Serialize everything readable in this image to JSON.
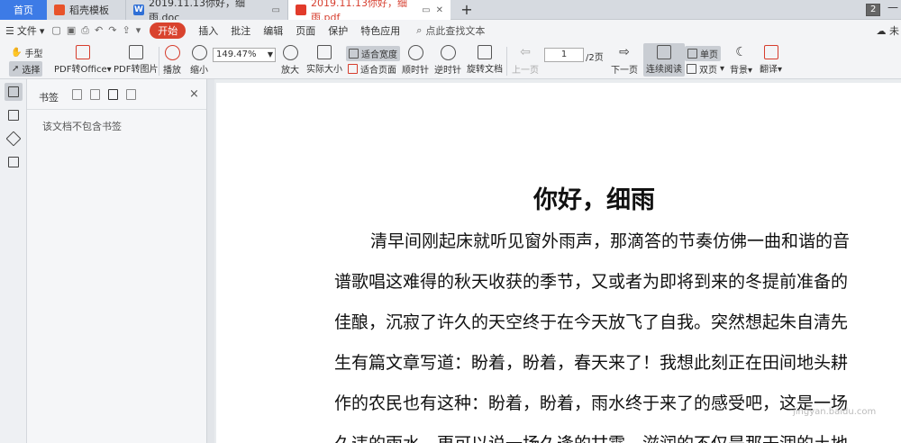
{
  "tabs": {
    "home": "首页",
    "tab1": "稻壳模板",
    "tab2": "2019.11.13你好，细雨.doc",
    "tab3": "2019.11.13你好，细雨.pdf",
    "doc_icon_letter": "W",
    "add": "+",
    "count": "2"
  },
  "menu": {
    "file": "文件",
    "start": "开始",
    "items": [
      "插入",
      "批注",
      "编辑",
      "页面",
      "保护",
      "特色应用"
    ],
    "search_hint": "点此查找文本",
    "cloud": "未"
  },
  "ribbon": {
    "hand": "手型",
    "select": "选择",
    "pdf_to_office": "PDF转Office",
    "pdf_to_image": "PDF转图片",
    "play": "播放",
    "zoom_out": "缩小",
    "zoom_value": "149.47%",
    "zoom_in": "放大",
    "actual_size": "实际大小",
    "fit_width": "适合宽度",
    "fit_page": "适合页面",
    "rotate_cw": "顺时针",
    "rotate_ccw": "逆时针",
    "rotate_doc": "旋转文档",
    "prev_page": "上一页",
    "page_current": "1",
    "page_total": "/2页",
    "next_page": "下一页",
    "continuous": "连续阅读",
    "single_page": "单页",
    "double_page": "双页",
    "background": "背景",
    "translate": "翻译"
  },
  "bookmarks": {
    "title": "书签",
    "empty": "该文档不包含书签",
    "close": "×"
  },
  "document": {
    "title": "你好，细雨",
    "lines": [
      "清早间刚起床就听见窗外雨声，那滴答的节奏仿佛一曲和谐的音",
      "谱歌唱这难得的秋天收获的季节，又或者为即将到来的冬提前准备的",
      "佳酿，沉寂了许久的天空终于在今天放飞了自我。突然想起朱自清先",
      "生有篇文章写道：盼着，盼着，春天来了！我想此刻正在田间地头耕",
      "作的农民也有这种：盼着，盼着，雨水终于来了的感受吧，这是一场",
      "久违的雨水，更可以说一场久逢的甘霖，滋润的不仅是那干涸的土地"
    ],
    "watermark": "jingyan.baidu.com"
  },
  "colors": {
    "accent_blue": "#3d7be6",
    "start_red": "#d9432e",
    "pdf_red": "#d63d2d"
  }
}
